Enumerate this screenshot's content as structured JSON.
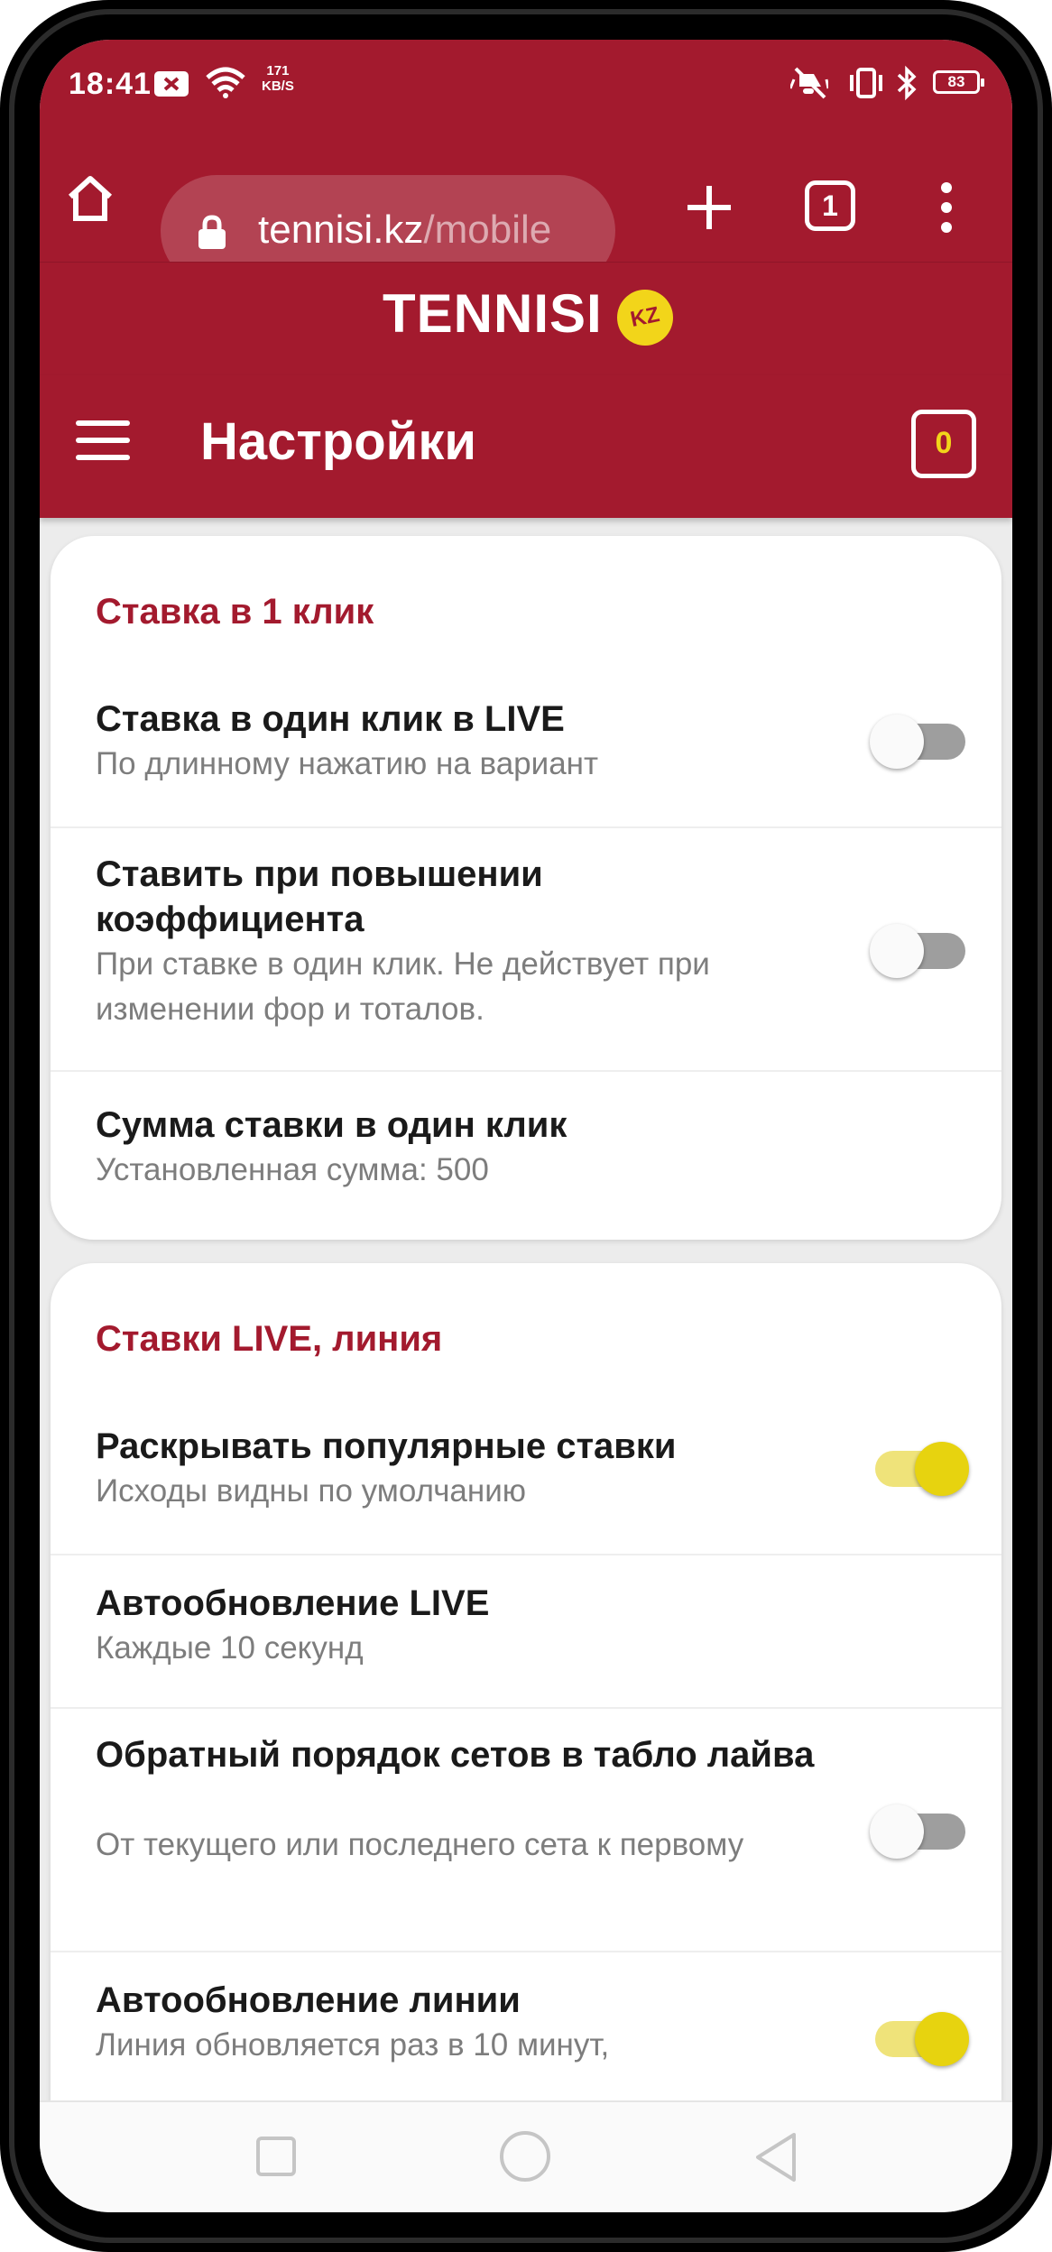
{
  "statusbar": {
    "time": "18:41",
    "speed_value": "171",
    "speed_unit": "KB/S",
    "battery": "83"
  },
  "browser": {
    "url_host": "tennisi.kz",
    "url_path": "/mobile",
    "tab_count": "1"
  },
  "brand": {
    "name": "TENNISI",
    "badge": "KZ"
  },
  "header": {
    "title": "Настройки",
    "coupon_count": "0"
  },
  "sections": [
    {
      "title": "Ставка в 1 клик",
      "items": [
        {
          "title": "Ставка в один клик в LIVE",
          "subtitle": "По длинному нажатию на вариант",
          "toggle": "off"
        },
        {
          "title": "Ставить при повышении коэффициента",
          "subtitle": "При ставке в один клик. Не действует при изменении фор и тоталов.",
          "toggle": "off"
        },
        {
          "title": "Сумма ставки в один клик",
          "subtitle": "Установленная сумма: 500",
          "toggle": null
        }
      ]
    },
    {
      "title": "Ставки LIVE, линия",
      "items": [
        {
          "title": "Раскрывать популярные ставки",
          "subtitle": "Исходы видны по умолчанию",
          "toggle": "on"
        },
        {
          "title": "Автообновление LIVE",
          "subtitle": "Каждые 10 секунд",
          "toggle": null
        },
        {
          "title": "Обратный порядок сетов в табло лайва",
          "subtitle": "От текущего или последнего сета к первому",
          "toggle": "off"
        },
        {
          "title": "Автообновление линии",
          "subtitle": "Линия обновляется раз в 10 минут,",
          "toggle": "on"
        }
      ]
    }
  ],
  "colors": {
    "brand_red": "#a31a2e",
    "accent_yellow": "#e7d30f",
    "section_title": "#a31a2e"
  },
  "icons": {
    "home": "home-icon",
    "lock": "lock-icon",
    "plus": "plus-icon",
    "menu": "more-vert-icon",
    "hamburger": "hamburger-icon",
    "coupon": "coupon-icon"
  }
}
